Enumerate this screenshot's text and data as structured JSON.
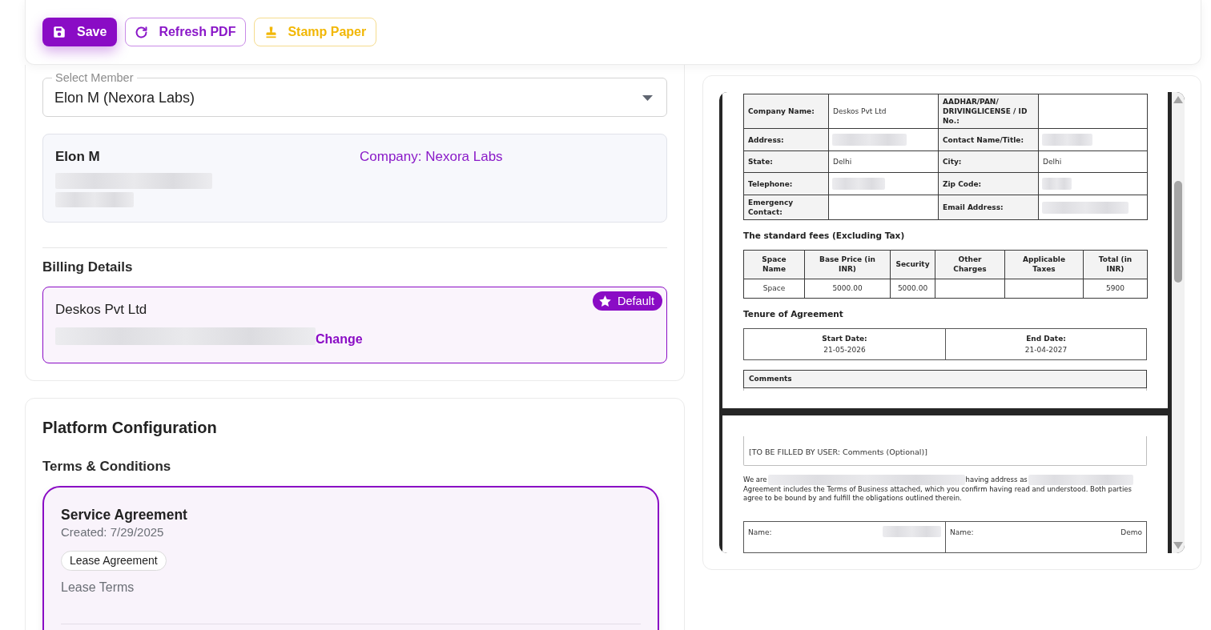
{
  "toolbar": {
    "buttons": [
      {
        "kind": "save",
        "label": "Save"
      },
      {
        "kind": "refresh",
        "label": "Refresh PDF"
      },
      {
        "kind": "stamp",
        "label": "Stamp Paper"
      }
    ]
  },
  "member_select": {
    "label": "Select Member",
    "value": "Elon M (Nexora Labs)"
  },
  "member_card": {
    "name": "Elon M",
    "company": "Company: Nexora Labs"
  },
  "billing": {
    "heading": "Billing Details",
    "accounts": [
      {
        "name": "Deskos Pvt Ltd",
        "badge": "Default",
        "link": "Change",
        "selected": true
      }
    ]
  },
  "platform_configuration": {
    "title": "Platform Configuration",
    "section": "Terms & Conditions",
    "templates": [
      {
        "title": "Service Agreement",
        "created": "Created: 7/29/2025",
        "tag": "Lease Agreement",
        "description": "Lease Terms",
        "selected": true
      }
    ]
  },
  "pdf_preview": {
    "pages": [
      {
        "blocks": [
          {
            "kind": "details_table",
            "rows": [
              [
                {
                  "kind": "label",
                  "text": "Company Name:"
                },
                {
                  "kind": "value",
                  "text": "Deskos Pvt Ltd"
                },
                {
                  "kind": "label",
                  "text": "AADHAR/PAN/ DRIVINGLICENSE / ID No.:"
                },
                {
                  "kind": "empty"
                }
              ],
              [
                {
                  "kind": "label",
                  "text": "Address:"
                },
                {
                  "kind": "redacted"
                },
                {
                  "kind": "label",
                  "text": "Contact Name/Title:"
                },
                {
                  "kind": "redacted"
                }
              ],
              [
                {
                  "kind": "label",
                  "text": "State:"
                },
                {
                  "kind": "value",
                  "text": "Delhi"
                },
                {
                  "kind": "label",
                  "text": "City:"
                },
                {
                  "kind": "value",
                  "text": "Delhi"
                }
              ],
              [
                {
                  "kind": "label",
                  "text": "Telephone:"
                },
                {
                  "kind": "redacted"
                },
                {
                  "kind": "label",
                  "text": "Zip Code:"
                },
                {
                  "kind": "redacted"
                }
              ],
              [
                {
                  "kind": "label",
                  "text": "Emergency Contact:"
                },
                {
                  "kind": "empty"
                },
                {
                  "kind": "label",
                  "text": "Email Address:"
                },
                {
                  "kind": "redacted"
                }
              ]
            ]
          },
          {
            "kind": "heading",
            "text": "The standard fees (Excluding Tax)"
          },
          {
            "kind": "fees_table",
            "columns": [
              "Space Name",
              "Base Price (in INR)",
              "Security",
              "Other Charges",
              "Applicable Taxes",
              "Total (in INR)"
            ],
            "rows": [
              [
                "Space",
                "5000.00",
                "5000.00",
                null,
                null,
                "5900"
              ]
            ]
          },
          {
            "kind": "heading",
            "text": "Tenure of Agreement"
          },
          {
            "kind": "dates_table",
            "items": [
              {
                "label": "Start Date:",
                "value": "21-05-2026"
              },
              {
                "label": "End Date:",
                "value": "21-04-2027"
              }
            ]
          },
          {
            "kind": "comments_header",
            "text": "Comments"
          }
        ]
      },
      {
        "blocks": [
          {
            "kind": "comments_body",
            "text": "[TO BE FILLED BY USER: Comments (Optional)]"
          },
          {
            "kind": "party_line",
            "parts": [
              {
                "kind": "text",
                "text": "We are"
              },
              {
                "kind": "redacted"
              },
              {
                "kind": "text",
                "text": "having address as"
              },
              {
                "kind": "redacted"
              }
            ]
          },
          {
            "kind": "paragraph",
            "text": "Agreement includes the Terms of Business attached, which you confirm having read and understood. Both parties agree to be bound by and fulfill the obligations outlined therein."
          },
          {
            "kind": "signature_table",
            "cells": [
              {
                "label": "Name:",
                "value": {
                  "kind": "redacted"
                }
              },
              {
                "label": "Name:",
                "value": {
                  "kind": "text",
                  "text": "Demo"
                }
              }
            ]
          }
        ]
      }
    ]
  }
}
